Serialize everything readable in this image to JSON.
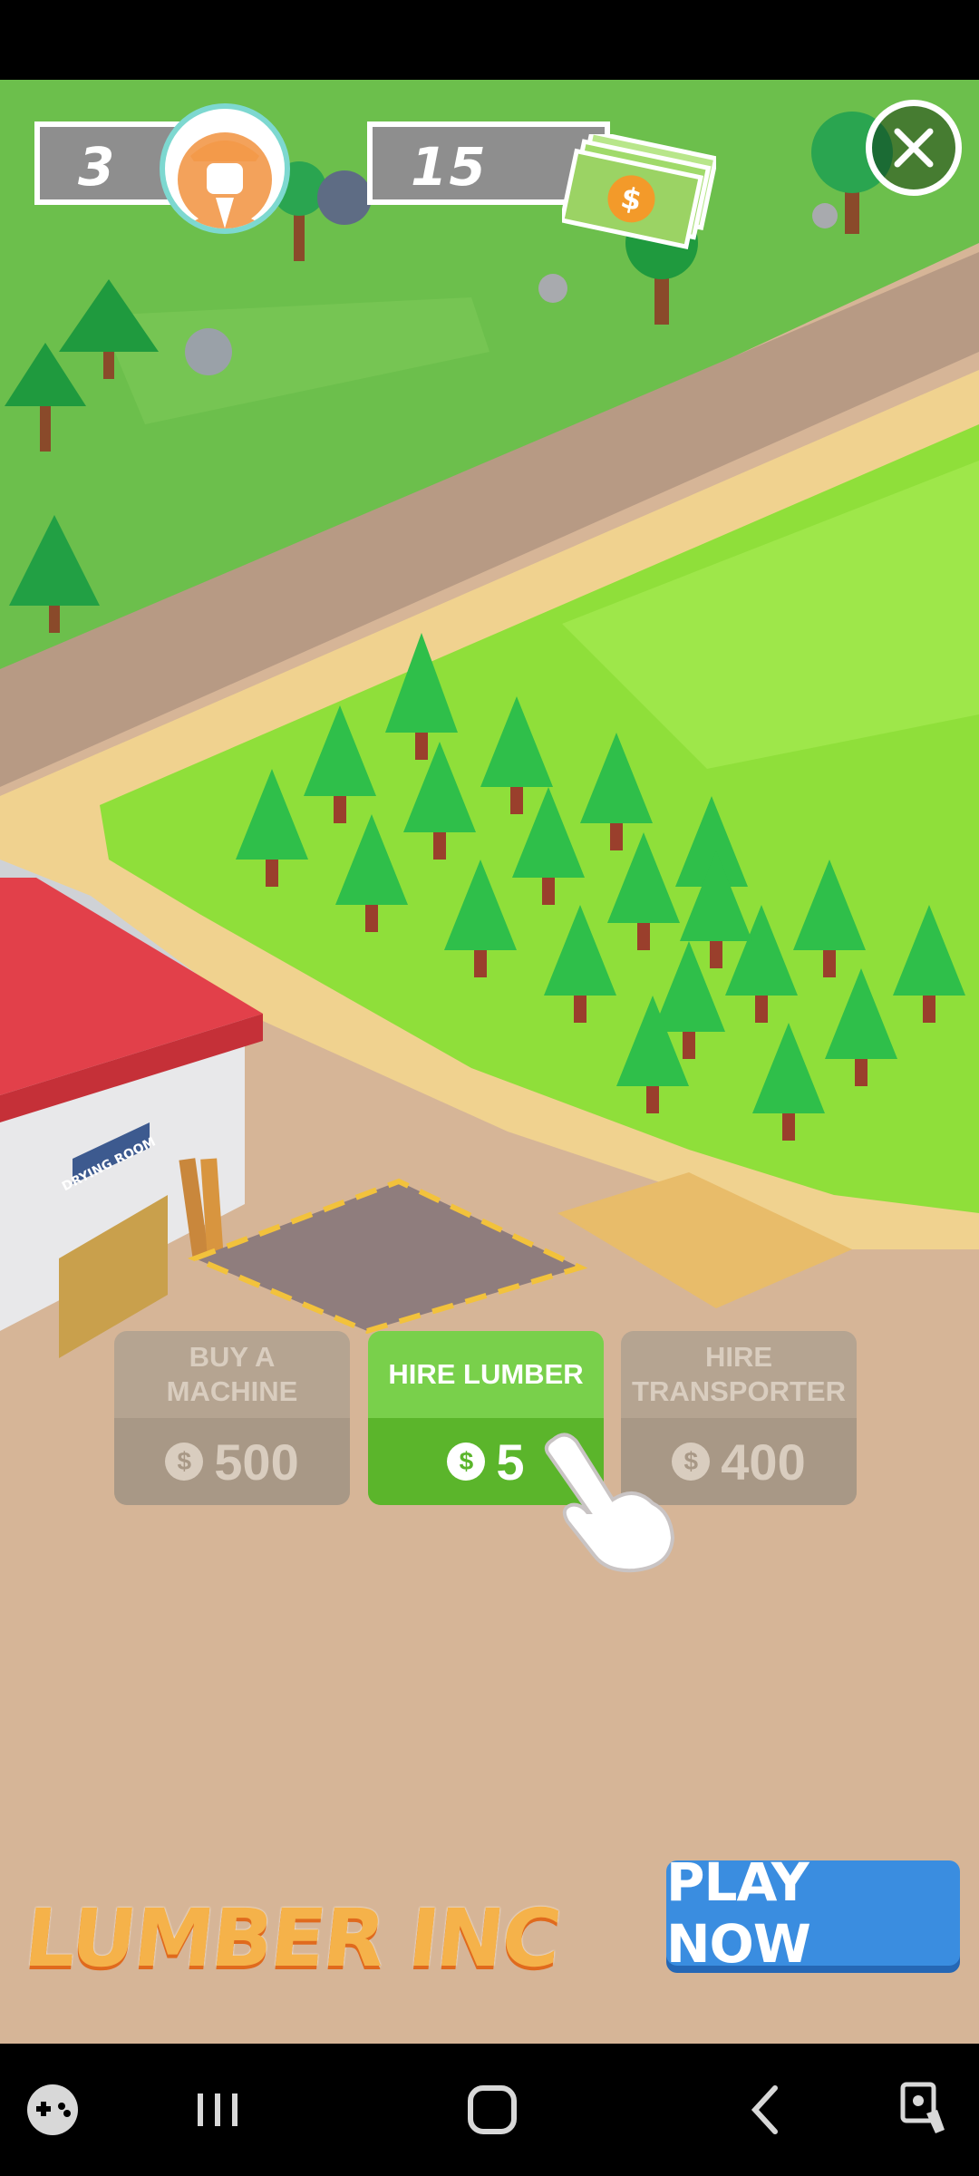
{
  "hud": {
    "workers": "3",
    "money": "15"
  },
  "actions": [
    {
      "label": "BUY A\nMACHINE",
      "price": "500",
      "enabled": false
    },
    {
      "label": "HIRE LUMBER",
      "price": "5",
      "enabled": true
    },
    {
      "label": "HIRE\nTRANSPORTER",
      "price": "400",
      "enabled": false
    }
  ],
  "scene": {
    "building_sign": "DRYING ROOM"
  },
  "footer": {
    "logo": "LUMBER INC",
    "play_button": "PLAY NOW"
  },
  "icons": {
    "close": "close-icon",
    "coin": "coin-icon",
    "cash": "cash-icon",
    "worker": "worker-avatar-icon",
    "hand": "tap-hand-icon"
  },
  "colors": {
    "ground": "#d6b597",
    "grass": "#6cbf4c",
    "field": "#8fdf3a",
    "road": "#b79a84",
    "button_enabled": "#79d04b",
    "button_disabled": "#b5a491",
    "play_button": "#3a8de0",
    "logo": "#f5b24a"
  }
}
